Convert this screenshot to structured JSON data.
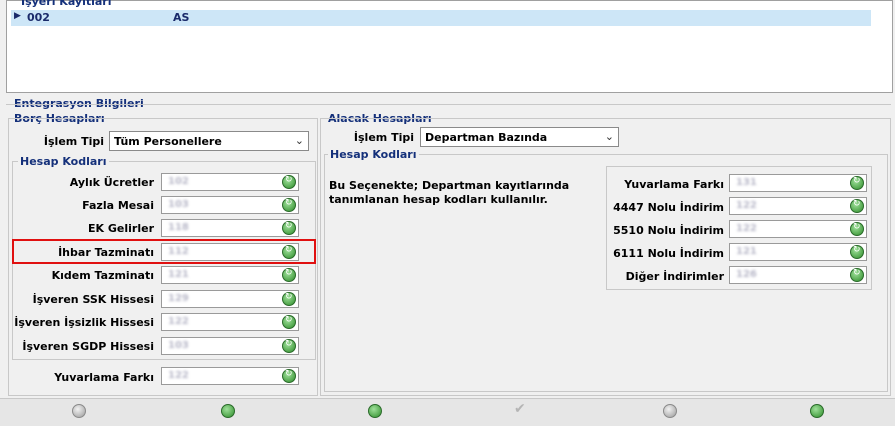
{
  "employer_records": {
    "title": "İşyeri Kayıtları",
    "row": {
      "code": "002",
      "name": "AS"
    }
  },
  "integration": {
    "title": "Entegrasyon Bilgileri",
    "debit": {
      "title": "Borç Hesapları",
      "op_type_label": "İşlem Tipi",
      "op_type_value": "Tüm Personellere",
      "codes_title": "Hesap Kodları",
      "fields": [
        {
          "label": "Aylık Ücretler",
          "value": "102"
        },
        {
          "label": "Fazla Mesai",
          "value": "103"
        },
        {
          "label": "EK Gelirler",
          "value": "118"
        },
        {
          "label": "İhbar Tazminatı",
          "value": "112"
        },
        {
          "label": "Kıdem Tazminatı",
          "value": "121"
        },
        {
          "label": "İşveren SSK Hissesi",
          "value": "129"
        },
        {
          "label": "İşveren İşsizlik Hissesi",
          "value": "122"
        },
        {
          "label": "İşveren SGDP Hissesi",
          "value": "103"
        }
      ],
      "rounding_label": "Yuvarlama Farkı",
      "rounding_value": "122"
    },
    "credit": {
      "title": "Alacak Hesapları",
      "op_type_label": "İşlem Tipi",
      "op_type_value": "Departman Bazında",
      "codes_title": "Hesap Kodları",
      "note": "Bu Seçenekte; Departman kayıtlarında tanımlanan hesap kodları kullanılır.",
      "fields": [
        {
          "label": "Yuvarlama Farkı",
          "value": "131"
        },
        {
          "label": "4447 Nolu İndirim",
          "value": "122"
        },
        {
          "label": "5510 Nolu İndirim",
          "value": "122"
        },
        {
          "label": "6111 Nolu İndirim",
          "value": "121"
        },
        {
          "label": "Diğer İndirimler",
          "value": "126"
        }
      ]
    }
  },
  "toolbar": {
    "icons": [
      "back-icon",
      "add-icon",
      "edit-icon",
      "save-check-icon",
      "delete-icon",
      "refresh-icon"
    ]
  },
  "colors": {
    "accent": "#14307a",
    "highlight": "#e01010",
    "selection": "#cde6f7"
  }
}
